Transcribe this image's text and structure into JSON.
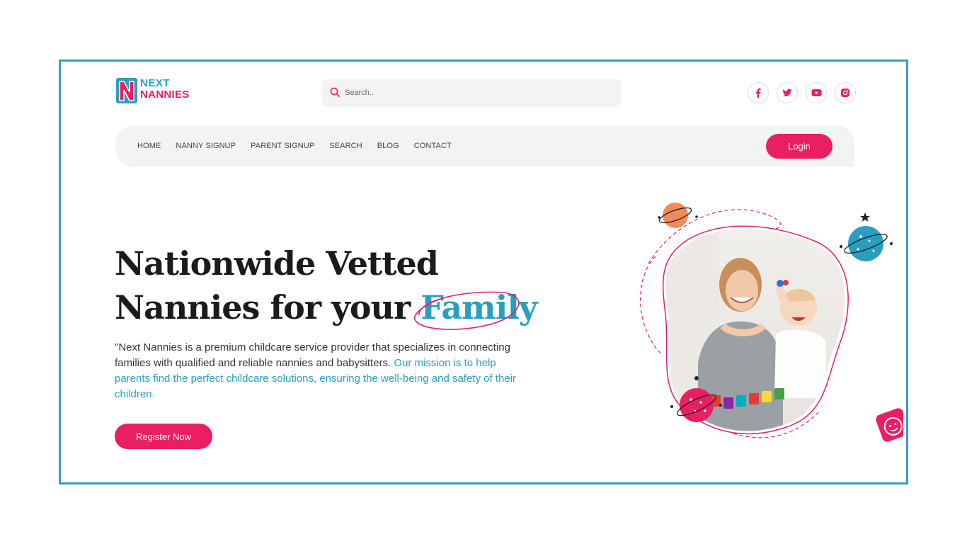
{
  "brand": {
    "line1": "NEXT",
    "line2": "NANNIES",
    "mark": "N"
  },
  "search": {
    "placeholder": "Search.."
  },
  "socials": [
    {
      "icon": "facebook-icon"
    },
    {
      "icon": "twitter-icon"
    },
    {
      "icon": "youtube-icon"
    },
    {
      "icon": "instagram-icon"
    }
  ],
  "nav": {
    "items": [
      "HOME",
      "NANNY SIGNUP",
      "PARENT SIGNUP",
      "SEARCH",
      "BLOG",
      "CONTACT"
    ],
    "login_label": "Login"
  },
  "hero": {
    "title_line1": "Nationwide Vetted",
    "title_line2_prefix": "Nannies for your ",
    "title_accent": "Family",
    "description_part1": "\"Next Nannies is a premium childcare service provider that specializes in connecting families with qualified and reliable nannies and babysitters. ",
    "description_part2": "Our mission is to help parents find the perfect childcare solutions, ensuring the well-being and safety of their children.",
    "register_label": "Register Now"
  },
  "colors": {
    "brand_pink": "#e91e63",
    "brand_blue": "#2a9ec0",
    "frame": "#3a9dbd",
    "nav_bg": "#f3f3f3"
  }
}
